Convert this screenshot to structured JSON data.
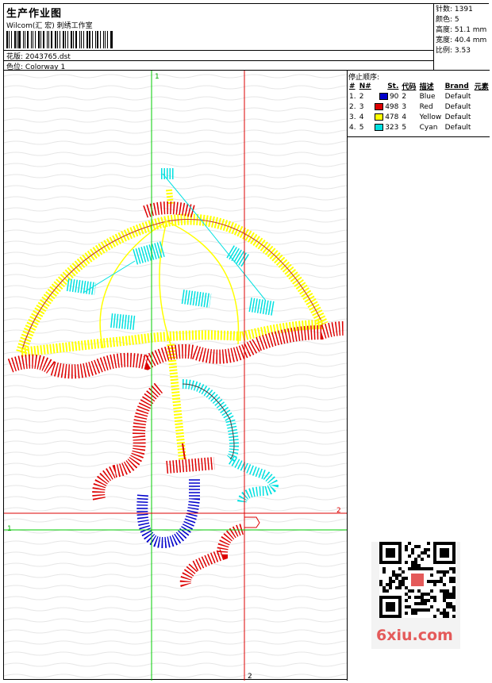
{
  "header": {
    "title": "生产作业图",
    "company": "Wilcom(汇 宏) 刺绣工作室",
    "design_label": "花版:",
    "design_value": "2043765.dst",
    "colorway_label": "色位:",
    "colorway_value": "Colorway 1"
  },
  "stats": {
    "stitches": "针数: 1391",
    "colors": "颜色: 5",
    "height": "高度: 51.1 mm",
    "width": "宽度: 40.4 mm",
    "scale": "比例: 3.53"
  },
  "stops": {
    "title": "停止顺序:",
    "columns": [
      "#",
      "N#",
      "St.",
      "代码",
      "描述",
      "Brand",
      "元素"
    ],
    "rows": [
      {
        "idx": "1.",
        "n": "2",
        "color": "#0000cc",
        "st": "90",
        "code": "2",
        "desc": "Blue",
        "brand": "Default"
      },
      {
        "idx": "2.",
        "n": "3",
        "color": "#dd0000",
        "st": "498",
        "code": "3",
        "desc": "Red",
        "brand": "Default"
      },
      {
        "idx": "3.",
        "n": "4",
        "color": "#ffff00",
        "st": "478",
        "code": "4",
        "desc": "Yellow",
        "brand": "Default"
      },
      {
        "idx": "4.",
        "n": "5",
        "color": "#00e0e0",
        "st": "323",
        "code": "5",
        "desc": "Cyan",
        "brand": "Default"
      }
    ]
  },
  "canvas": {
    "guide_label_v1": "1",
    "guide_label_h1": "1",
    "guide_label_v2": "2",
    "guide_label_h2": "2",
    "guide_green": "#00cc00",
    "guide_red": "#dd0000"
  },
  "watermark": {
    "text": "6xiu.com",
    "color": "#e45a5a"
  }
}
